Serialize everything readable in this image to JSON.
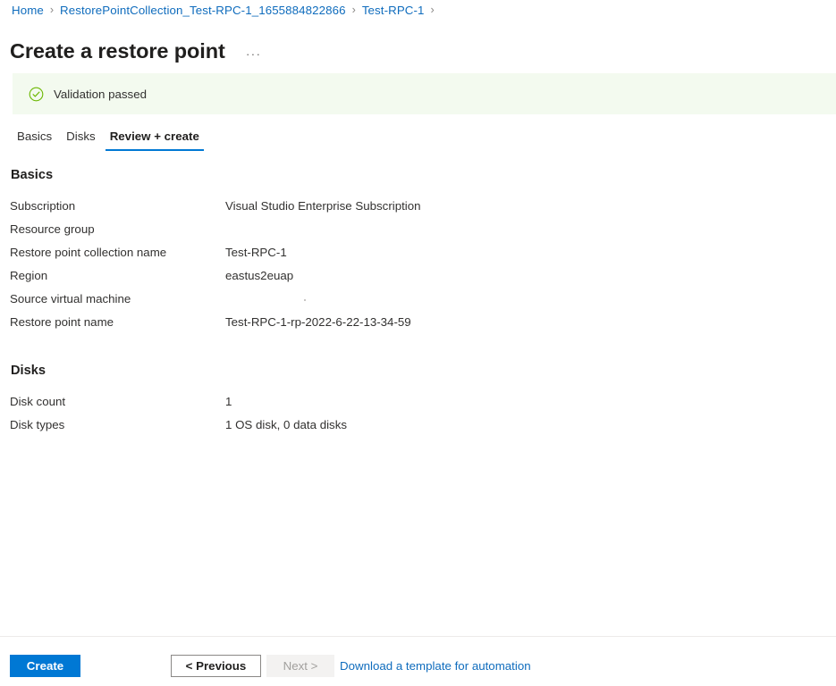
{
  "breadcrumb": {
    "items": [
      {
        "label": "Home"
      },
      {
        "label": "RestorePointCollection_Test-RPC-1_1655884822866"
      },
      {
        "label": "Test-RPC-1"
      }
    ],
    "separator": "›",
    "trailing_separator": "›",
    "link_color": "#0f6cbd"
  },
  "header": {
    "title": "Create a restore point",
    "more_icon": "ellipsis-horizontal-icon",
    "more_label": "···"
  },
  "validation": {
    "icon": "check-circle-icon",
    "message": "Validation passed",
    "background": "#f3faef",
    "icon_color": "#6bb700"
  },
  "tabs": {
    "items": [
      {
        "label": "Basics",
        "active": false
      },
      {
        "label": "Disks",
        "active": false
      },
      {
        "label": "Review + create",
        "active": true
      }
    ],
    "active_underline_color": "#0078d4"
  },
  "sections": [
    {
      "heading": "Basics",
      "rows": [
        {
          "label": "Subscription",
          "value": "Visual Studio Enterprise Subscription"
        },
        {
          "label": "Resource group",
          "value": ""
        },
        {
          "label": "Restore point collection name",
          "value": "Test-RPC-1"
        },
        {
          "label": "Region",
          "value": "eastus2euap"
        },
        {
          "label": "Source virtual machine",
          "value": ""
        },
        {
          "label": "Restore point name",
          "value": "Test-RPC-1-rp-2022-6-22-13-34-59"
        }
      ]
    },
    {
      "heading": "Disks",
      "rows": [
        {
          "label": "Disk count",
          "value": "1"
        },
        {
          "label": "Disk types",
          "value": "1 OS disk, 0 data disks"
        }
      ]
    }
  ],
  "footer": {
    "create_label": "Create",
    "previous_label": "< Previous",
    "next_label": "Next >",
    "next_disabled": true,
    "template_link_label": "Download a template for automation",
    "primary_color": "#0078d4",
    "link_color": "#0f6cbd"
  }
}
